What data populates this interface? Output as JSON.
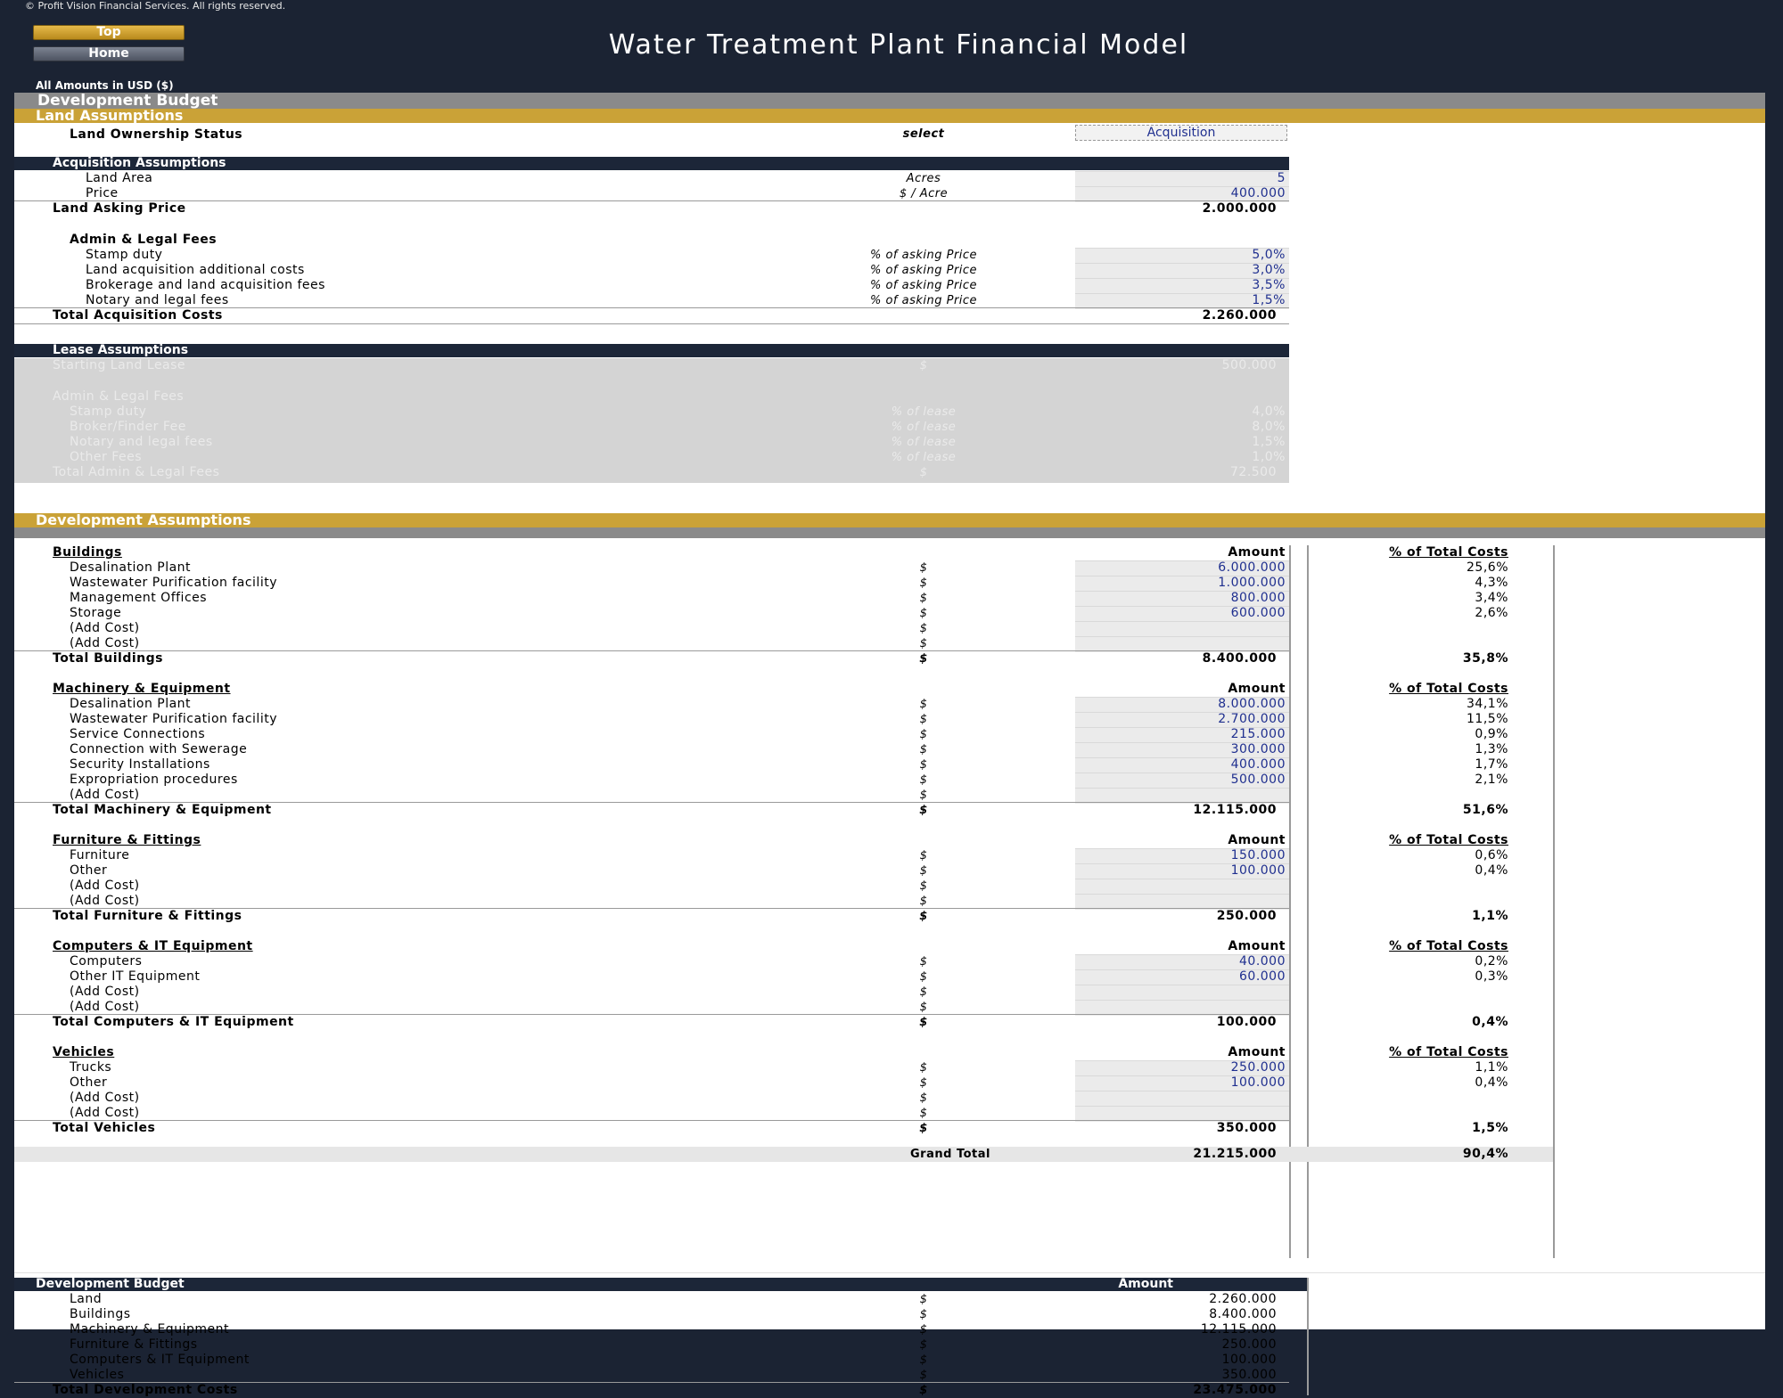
{
  "header": {
    "copyright": "© Profit Vision Financial Services. All rights reserved.",
    "nav_top": "Top",
    "nav_home": "Home",
    "title": "Water Treatment Plant Financial Model",
    "amounts_note": "All Amounts in  USD ($)"
  },
  "sections": {
    "development_budget": "Development Budget",
    "land_assumptions": "Land Assumptions",
    "development_assumptions": "Development Assumptions"
  },
  "land": {
    "ownership_label": "Land Ownership Status",
    "ownership_hint": "select",
    "ownership_value": "Acquisition"
  },
  "acquisition": {
    "header": "Acquisition Assumptions",
    "rows": [
      {
        "label": "Land Area",
        "unit": "Acres",
        "value": "5"
      },
      {
        "label": "Price",
        "unit": "$ / Acre",
        "value": "400.000"
      }
    ],
    "asking_label": "Land Asking Price",
    "asking_value": "2.000.000",
    "fees_header": "Admin & Legal Fees",
    "fees": [
      {
        "label": "Stamp duty",
        "unit": "% of asking Price",
        "value": "5,0%"
      },
      {
        "label": "Land acquisition additional costs",
        "unit": "% of asking Price",
        "value": "3,0%"
      },
      {
        "label": "Brokerage and land acquisition fees",
        "unit": "% of asking Price",
        "value": "3,5%"
      },
      {
        "label": "Notary and legal fees",
        "unit": "% of asking Price",
        "value": "1,5%"
      }
    ],
    "total_label": "Total Acquisition Costs",
    "total_value": "2.260.000"
  },
  "lease": {
    "header": "Lease Assumptions",
    "starting_label": "Starting Land Lease",
    "starting_unit": "$",
    "starting_value": "500.000",
    "fees_header": "Admin & Legal Fees",
    "fees": [
      {
        "label": "Stamp duty",
        "unit": "% of lease",
        "value": "4,0%"
      },
      {
        "label": "Broker/Finder Fee",
        "unit": "% of lease",
        "value": "8,0%"
      },
      {
        "label": "Notary and legal fees",
        "unit": "% of lease",
        "value": "1,5%"
      },
      {
        "label": "Other Fees",
        "unit": "% of lease",
        "value": "1,0%"
      }
    ],
    "total_label": "Total Admin & Legal Fees",
    "total_unit": "$",
    "total_value": "72.500"
  },
  "col_headers": {
    "amount": "Amount",
    "pct": "% of Total Costs"
  },
  "categories": [
    {
      "title": "Buildings",
      "items": [
        {
          "label": "Desalination Plant",
          "unit": "$",
          "amount": "6.000.000",
          "pct": "25,6%"
        },
        {
          "label": "Wastewater Purification facility",
          "unit": "$",
          "amount": "1.000.000",
          "pct": "4,3%"
        },
        {
          "label": "Management Offices",
          "unit": "$",
          "amount": "800.000",
          "pct": "3,4%"
        },
        {
          "label": "Storage",
          "unit": "$",
          "amount": "600.000",
          "pct": "2,6%"
        },
        {
          "label": "(Add Cost)",
          "unit": "$",
          "amount": "",
          "pct": ""
        },
        {
          "label": "(Add Cost)",
          "unit": "$",
          "amount": "",
          "pct": ""
        }
      ],
      "total_label": "Total Buildings",
      "total_unit": "$",
      "total_amount": "8.400.000",
      "total_pct": "35,8%"
    },
    {
      "title": "Machinery & Equipment",
      "items": [
        {
          "label": "Desalination Plant",
          "unit": "$",
          "amount": "8.000.000",
          "pct": "34,1%"
        },
        {
          "label": "Wastewater Purification facility",
          "unit": "$",
          "amount": "2.700.000",
          "pct": "11,5%"
        },
        {
          "label": "Service Connections",
          "unit": "$",
          "amount": "215.000",
          "pct": "0,9%"
        },
        {
          "label": "Connection with Sewerage",
          "unit": "$",
          "amount": "300.000",
          "pct": "1,3%"
        },
        {
          "label": "Security Installations",
          "unit": "$",
          "amount": "400.000",
          "pct": "1,7%"
        },
        {
          "label": "Expropriation procedures",
          "unit": "$",
          "amount": "500.000",
          "pct": "2,1%"
        },
        {
          "label": "(Add Cost)",
          "unit": "$",
          "amount": "",
          "pct": ""
        }
      ],
      "total_label": "Total Machinery & Equipment",
      "total_unit": "$",
      "total_amount": "12.115.000",
      "total_pct": "51,6%"
    },
    {
      "title": "Furniture & Fittings",
      "items": [
        {
          "label": "Furniture",
          "unit": "$",
          "amount": "150.000",
          "pct": "0,6%"
        },
        {
          "label": "Other",
          "unit": "$",
          "amount": "100.000",
          "pct": "0,4%"
        },
        {
          "label": "(Add Cost)",
          "unit": "$",
          "amount": "",
          "pct": ""
        },
        {
          "label": "(Add Cost)",
          "unit": "$",
          "amount": "",
          "pct": ""
        }
      ],
      "total_label": "Total Furniture & Fittings",
      "total_unit": "$",
      "total_amount": "250.000",
      "total_pct": "1,1%"
    },
    {
      "title": "Computers & IT Equipment",
      "items": [
        {
          "label": "Computers",
          "unit": "$",
          "amount": "40.000",
          "pct": "0,2%"
        },
        {
          "label": "Other IT Equipment",
          "unit": "$",
          "amount": "60.000",
          "pct": "0,3%"
        },
        {
          "label": "(Add Cost)",
          "unit": "$",
          "amount": "",
          "pct": ""
        },
        {
          "label": "(Add Cost)",
          "unit": "$",
          "amount": "",
          "pct": ""
        }
      ],
      "total_label": "Total Computers & IT Equipment",
      "total_unit": "$",
      "total_amount": "100.000",
      "total_pct": "0,4%"
    },
    {
      "title": "Vehicles",
      "items": [
        {
          "label": "Trucks",
          "unit": "$",
          "amount": "250.000",
          "pct": "1,1%"
        },
        {
          "label": "Other",
          "unit": "$",
          "amount": "100.000",
          "pct": "0,4%"
        },
        {
          "label": "(Add Cost)",
          "unit": "$",
          "amount": "",
          "pct": ""
        },
        {
          "label": "(Add Cost)",
          "unit": "$",
          "amount": "",
          "pct": ""
        }
      ],
      "total_label": "Total Vehicles",
      "total_unit": "$",
      "total_amount": "350.000",
      "total_pct": "1,5%"
    }
  ],
  "grand_total": {
    "label": "Grand Total",
    "amount": "21.215.000",
    "pct": "90,4%"
  },
  "summary": {
    "header": "Development Budget",
    "amount_header": "Amount",
    "rows": [
      {
        "label": "Land",
        "unit": "$",
        "value": "2.260.000"
      },
      {
        "label": "Buildings",
        "unit": "$",
        "value": "8.400.000"
      },
      {
        "label": "Machinery & Equipment",
        "unit": "$",
        "value": "12.115.000"
      },
      {
        "label": "Furniture & Fittings",
        "unit": "$",
        "value": "250.000"
      },
      {
        "label": "Computers & IT Equipment",
        "unit": "$",
        "value": "100.000"
      },
      {
        "label": "Vehicles",
        "unit": "$",
        "value": "350.000"
      }
    ],
    "total_label": "Total Development Costs",
    "total_unit": "$",
    "total_value": "23.475.000"
  },
  "colors": {
    "navy": "#1c2638",
    "gold": "#caa237",
    "gray_band": "#8a8a8a",
    "input_blue": "#1f2f8f",
    "input_fill": "#ebebeb"
  }
}
